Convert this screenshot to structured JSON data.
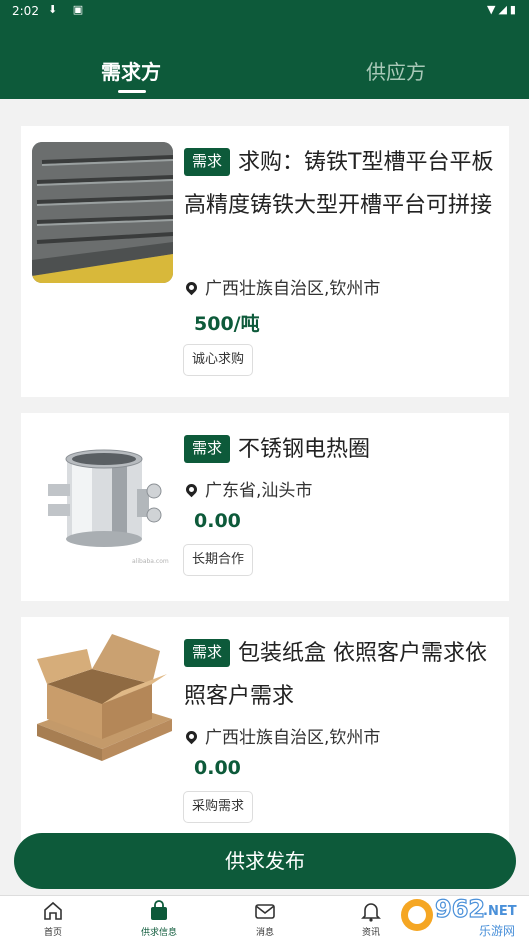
{
  "status_bar": {
    "time": "2:02"
  },
  "tabs": [
    {
      "label": "需求方",
      "active": true
    },
    {
      "label": "供应方",
      "active": false
    }
  ],
  "badge_label": "需求",
  "items": [
    {
      "title": "求购：铸铁T型槽平台平板 高精度铸铁大型开槽平台可拼接",
      "location": "广西壮族自治区,钦州市",
      "price": "500/吨",
      "tag": "诚心求购",
      "image": "cast-iron-t-slot-platform"
    },
    {
      "title": "不锈钢电热圈",
      "location": "广东省,汕头市",
      "price": "0.00",
      "tag": "长期合作",
      "image": "stainless-steel-heating-band"
    },
    {
      "title": "包装纸盒 依照客户需求依照客户需求",
      "location": "广西壮族自治区,钦州市",
      "price": "0.00",
      "tag": "采购需求",
      "image": "cardboard-boxes"
    }
  ],
  "publish_button": "供求发布",
  "bottom_nav": [
    {
      "label": "首页",
      "icon": "home-icon",
      "active": false
    },
    {
      "label": "供求信息",
      "icon": "shopping-bag-icon",
      "active": true
    },
    {
      "label": "消息",
      "icon": "mail-icon",
      "active": false
    },
    {
      "label": "资讯",
      "icon": "bell-icon",
      "active": false
    }
  ],
  "colors": {
    "brand": "#0d5a3a",
    "background": "#f2f2f2"
  }
}
